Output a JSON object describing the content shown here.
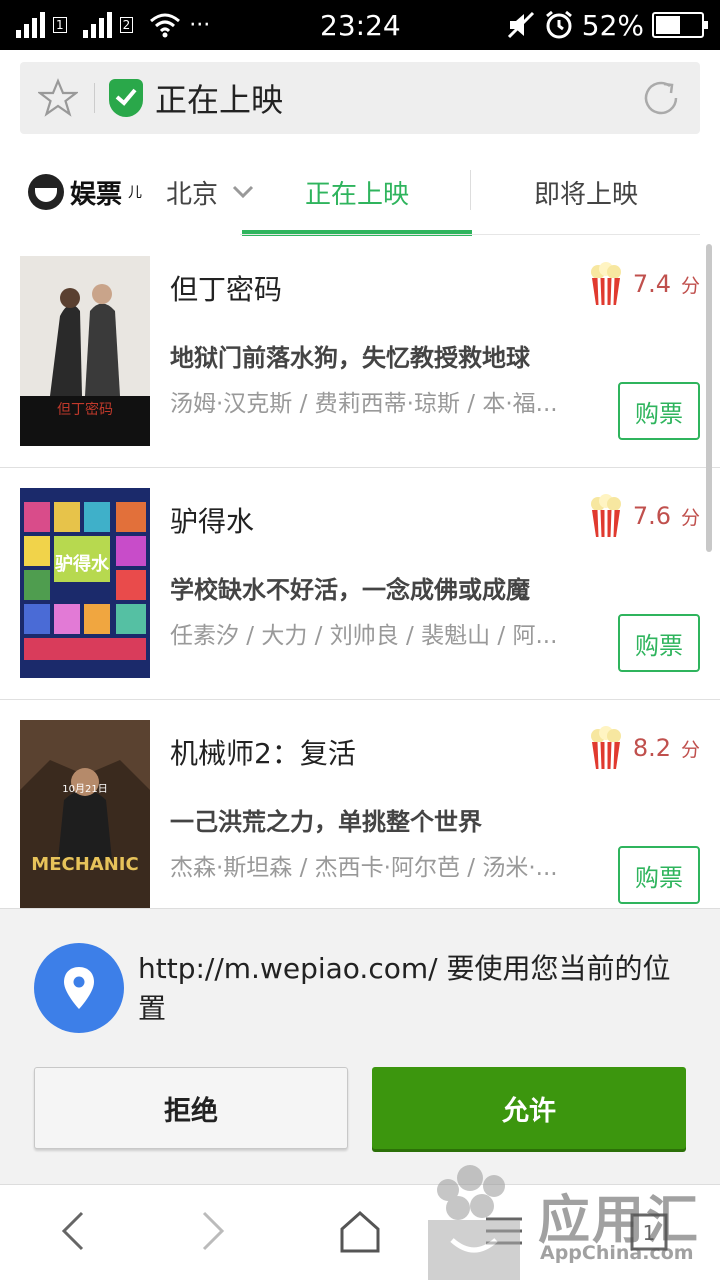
{
  "status_bar": {
    "time": "23:24",
    "battery": "52%",
    "sim1": "1",
    "sim2": "2",
    "more": "···",
    "battery_level": 0.52
  },
  "browser": {
    "page_title": "正在上映"
  },
  "nav": {
    "logo_text": "娱票",
    "logo_suffix": "儿",
    "city": "北京",
    "tabs": [
      {
        "label": "正在上映",
        "active": true
      },
      {
        "label": "即将上映",
        "active": false
      }
    ],
    "accent_color": "#2fb45d"
  },
  "movies": [
    {
      "title": "但丁密码",
      "tagline": "地狱门前落水狗，失忆教授救地球",
      "cast": "汤姆·汉克斯 / 费莉西蒂·琼斯 / 本·福...",
      "score": "7.4",
      "unit": "分",
      "buy_label": "购票",
      "poster_text": "但丁密码"
    },
    {
      "title": "驴得水",
      "tagline": "学校缺水不好活，一念成佛或成魔",
      "cast": "任素汐 / 大力 / 刘帅良 / 裴魁山 / 阿...",
      "score": "7.6",
      "unit": "分",
      "buy_label": "购票",
      "poster_text": "驴得水"
    },
    {
      "title": "机械师2：复活",
      "tagline": "一己洪荒之力，单挑整个世界",
      "cast": "杰森·斯坦森 / 杰西卡·阿尔芭 / 汤米·...",
      "score": "8.2",
      "unit": "分",
      "buy_label": "购票",
      "poster_text": "MECHANIC",
      "poster_date": "10月21日"
    }
  ],
  "permission": {
    "message": "http://m.wepiao.com/ 要使用您当前的位置",
    "deny_label": "拒绝",
    "allow_label": "允许"
  },
  "watermark": {
    "name": "应用汇",
    "en": "AppChina.com"
  },
  "icons": [
    "signal-icon",
    "wifi-icon",
    "mute-icon",
    "alarm-icon",
    "battery-icon",
    "star-icon",
    "shield-check-icon",
    "refresh-icon",
    "chevron-down-icon",
    "popcorn-icon",
    "location-pin-icon",
    "back-icon",
    "forward-icon",
    "home-icon",
    "menu-icon",
    "tabs-icon"
  ]
}
